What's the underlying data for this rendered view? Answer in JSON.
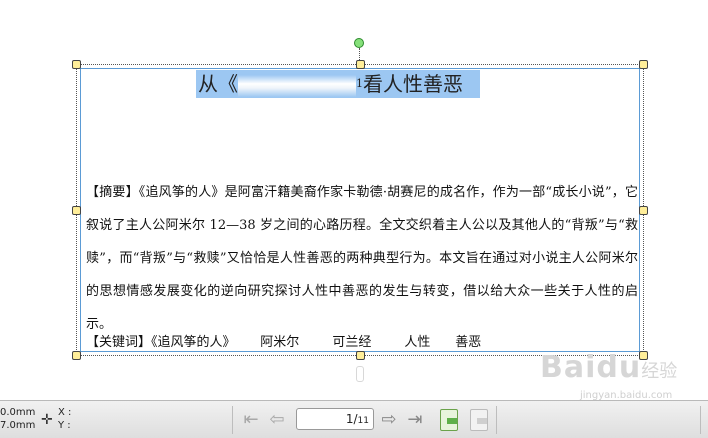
{
  "document": {
    "title_before": "从《",
    "title_after": "看人性善恶",
    "footnote": "1",
    "abstract": "【摘要】《追风筝的人》是阿富汗籍美裔作家卡勒德·胡赛尼的成名作，作为一部“成长小说”，它叙说了主人公阿米尔 12—38 岁之间的心路历程。全文交织着主人公以及其他人的“背叛”与“救赎”，而“背叛”与“救赎”又恰恰是人性善恶的两种典型行为。本文旨在通过对小说主人公阿米尔的思想情感发展变化的逆向研究探讨人性中善恶的发生与转变，借以给大众一些关于人性的启示。",
    "keywords": "【关键词】《追风筝的人》      阿米尔        可兰经        人性      善恶"
  },
  "statusbar": {
    "width_value": "0.0mm",
    "height_value": "7.0mm",
    "x_label": "X :",
    "y_label": "Y :",
    "current_page": "1",
    "total_pages": "11"
  },
  "watermark": {
    "brand": "Baidu",
    "brand_suffix": "经验",
    "url": "jingyan.baidu.com"
  }
}
